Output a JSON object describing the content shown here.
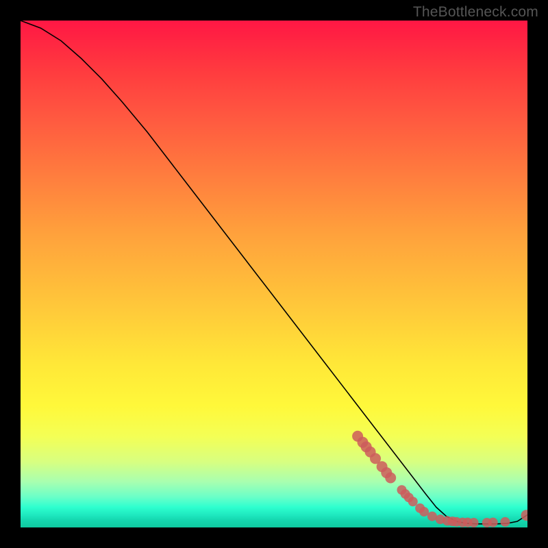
{
  "watermark": "TheBottleneck.com",
  "chart_data": {
    "type": "line",
    "title": "",
    "xlabel": "",
    "ylabel": "",
    "xlim": [
      0,
      100
    ],
    "ylim": [
      0,
      100
    ],
    "series": [
      {
        "name": "curve",
        "x": [
          0,
          4,
          8,
          12,
          16,
          20,
          25,
          30,
          35,
          40,
          45,
          50,
          55,
          60,
          65,
          70,
          75,
          80,
          82,
          84,
          86,
          88,
          90,
          92,
          94,
          96,
          98,
          100
        ],
        "y": [
          100,
          98.5,
          96,
          92.5,
          88.5,
          84,
          78,
          71.5,
          65,
          58.5,
          52,
          45.5,
          39,
          32.5,
          26,
          19.5,
          13,
          6.5,
          4,
          2.2,
          1.2,
          0.8,
          0.7,
          0.7,
          0.7,
          0.8,
          1.2,
          2.5
        ]
      }
    ],
    "scatter": {
      "name": "dots",
      "points": [
        {
          "x": 66.5,
          "y": 18.0,
          "r": 8
        },
        {
          "x": 67.5,
          "y": 16.8,
          "r": 8
        },
        {
          "x": 68.2,
          "y": 15.9,
          "r": 8
        },
        {
          "x": 69.0,
          "y": 14.9,
          "r": 8
        },
        {
          "x": 70.0,
          "y": 13.6,
          "r": 8
        },
        {
          "x": 71.3,
          "y": 12.0,
          "r": 8
        },
        {
          "x": 72.2,
          "y": 10.8,
          "r": 8
        },
        {
          "x": 73.0,
          "y": 9.8,
          "r": 8
        },
        {
          "x": 75.2,
          "y": 7.4,
          "r": 7
        },
        {
          "x": 75.9,
          "y": 6.6,
          "r": 7
        },
        {
          "x": 76.6,
          "y": 5.9,
          "r": 7
        },
        {
          "x": 77.4,
          "y": 5.1,
          "r": 7
        },
        {
          "x": 78.8,
          "y": 3.8,
          "r": 7
        },
        {
          "x": 79.6,
          "y": 3.1,
          "r": 7
        },
        {
          "x": 81.2,
          "y": 2.2,
          "r": 7
        },
        {
          "x": 82.8,
          "y": 1.6,
          "r": 7
        },
        {
          "x": 84.2,
          "y": 1.3,
          "r": 7
        },
        {
          "x": 85.2,
          "y": 1.2,
          "r": 7
        },
        {
          "x": 86.0,
          "y": 1.1,
          "r": 7
        },
        {
          "x": 87.2,
          "y": 1.0,
          "r": 7
        },
        {
          "x": 88.2,
          "y": 1.0,
          "r": 7
        },
        {
          "x": 89.4,
          "y": 0.95,
          "r": 7
        },
        {
          "x": 92.0,
          "y": 0.95,
          "r": 7
        },
        {
          "x": 93.2,
          "y": 1.0,
          "r": 7
        },
        {
          "x": 95.6,
          "y": 1.1,
          "r": 7
        },
        {
          "x": 99.8,
          "y": 2.4,
          "r": 8
        }
      ]
    }
  }
}
